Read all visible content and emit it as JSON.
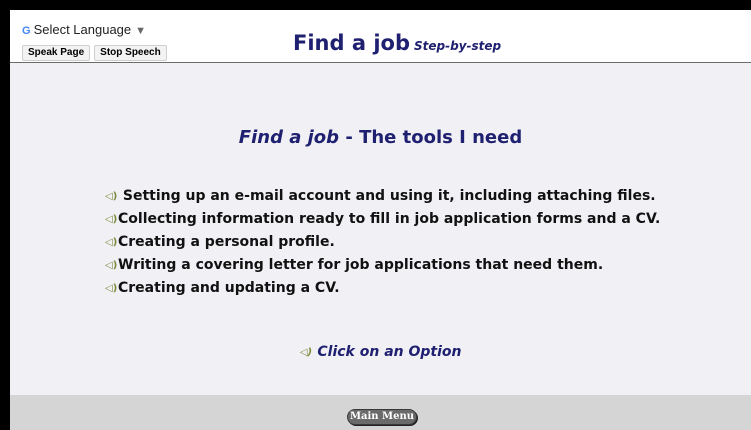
{
  "header": {
    "language_select": {
      "icon": "google-g-icon",
      "label": "Select Language"
    },
    "speak_page_label": "Speak Page",
    "stop_speech_label": "Stop Speech",
    "title": "Find a job",
    "subtitle": "Step-by-step"
  },
  "main": {
    "heading_italic": "Find a job",
    "heading_rest": " - The tools I need",
    "items": [
      {
        "label": "Setting up an e-mail account and using it, including attaching files."
      },
      {
        "label": "Collecting information ready to fill in job application forms and a CV."
      },
      {
        "label": "Creating a personal profile."
      },
      {
        "label": "Writing a covering letter for job applications that need them."
      },
      {
        "label": "Creating and updating a CV."
      }
    ],
    "cta": "Click on an Option"
  },
  "footer": {
    "main_menu_label": "Main Menu"
  },
  "colors": {
    "title": "#1f2070",
    "content_bg": "#f0f0f5",
    "footer_bg": "#d5d5d5"
  },
  "icons": {
    "speaker": "speaker-icon",
    "dropdown": "dropdown-arrow-icon"
  }
}
